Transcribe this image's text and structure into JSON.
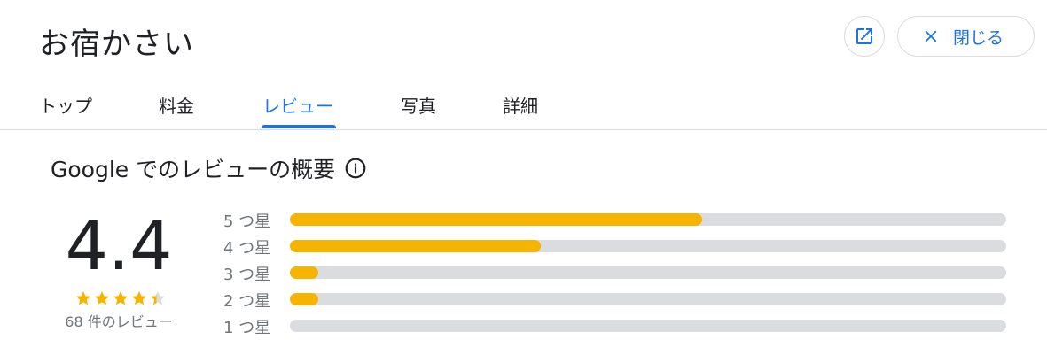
{
  "header": {
    "title": "お宿かさい",
    "open_icon": "open-in-new-icon",
    "close_icon": "close-icon",
    "close_label": "閉じる"
  },
  "tabs": [
    {
      "label": "トップ",
      "active": false
    },
    {
      "label": "料金",
      "active": false
    },
    {
      "label": "レビュー",
      "active": true
    },
    {
      "label": "写真",
      "active": false
    },
    {
      "label": "詳細",
      "active": false
    }
  ],
  "summary": {
    "title": "Google でのレビューの概要",
    "info_icon": "info-icon",
    "score": "4.4",
    "stars": 4.4,
    "review_count": "68 件のレビュー"
  },
  "distribution": [
    {
      "label": "5 つ星",
      "fraction": 0.575
    },
    {
      "label": "4 つ星",
      "fraction": 0.35
    },
    {
      "label": "3 つ星",
      "fraction": 0.04
    },
    {
      "label": "2 つ星",
      "fraction": 0.04
    },
    {
      "label": "1 つ星",
      "fraction": 0.0
    }
  ],
  "colors": {
    "accent": "#1a73e8",
    "bar_fill": "#f6b400",
    "bar_track": "#dadce0",
    "star": "#f6b400",
    "star_empty": "#dadce0"
  }
}
